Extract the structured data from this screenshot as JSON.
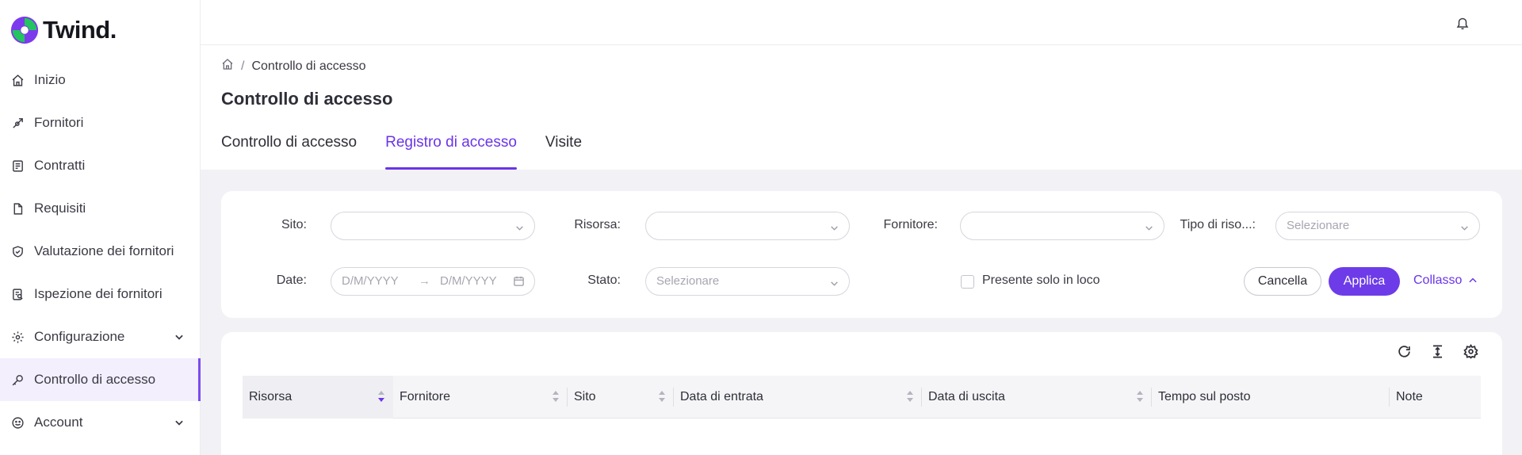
{
  "app": {
    "logo_text": "Twind."
  },
  "sidebar": {
    "items": [
      {
        "label": "Inizio",
        "icon": "home-icon"
      },
      {
        "label": "Fornitori",
        "icon": "link-icon"
      },
      {
        "label": "Contratti",
        "icon": "contract-icon"
      },
      {
        "label": "Requisiti",
        "icon": "document-icon"
      },
      {
        "label": "Valutazione dei fornitori",
        "icon": "shield-check-icon"
      },
      {
        "label": "Ispezione dei fornitori",
        "icon": "inspection-icon"
      },
      {
        "label": "Configurazione",
        "icon": "gear-icon",
        "expandable": true
      },
      {
        "label": "Controllo di accesso",
        "icon": "key-icon",
        "active": true
      },
      {
        "label": "Account",
        "icon": "account-icon",
        "expandable": true
      }
    ]
  },
  "breadcrumb": {
    "current": "Controllo di accesso"
  },
  "page": {
    "title": "Controllo di accesso"
  },
  "tabs": [
    {
      "label": "Controllo di accesso"
    },
    {
      "label": "Registro di accesso",
      "active": true
    },
    {
      "label": "Visite"
    }
  ],
  "filters": {
    "sito_label": "Sito",
    "risorsa_label": "Risorsa",
    "fornitore_label": "Fornitore",
    "tipo_label": "Tipo di riso...",
    "tipo_placeholder": "Selezionare",
    "date_label": "Date",
    "date_start_placeholder": "D/M/YYYY",
    "date_end_placeholder": "D/M/YYYY",
    "stato_label": "Stato",
    "stato_placeholder": "Selezionare",
    "onsite_label": "Presente solo in loco",
    "cancel_label": "Cancella",
    "apply_label": "Applica",
    "collapse_label": "Collasso"
  },
  "table": {
    "columns": [
      "Risorsa",
      "Fornitore",
      "Sito",
      "Data di entrata",
      "Data di uscita",
      "Tempo sul posto",
      "Note"
    ]
  },
  "colors": {
    "accent": "#6d3ce8",
    "background": "#f2f2f6"
  }
}
